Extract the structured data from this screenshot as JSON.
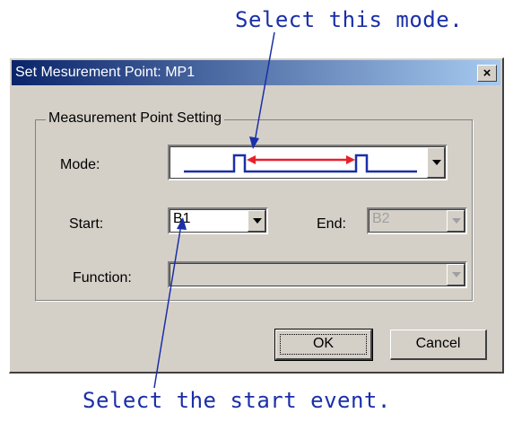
{
  "annotations": {
    "top": "Select this mode.",
    "bottom": "Select the start event."
  },
  "dialog": {
    "title": "Set Mesurement Point: MP1",
    "close_symbol": "×",
    "group_title": "Measurement Point Setting",
    "mode": {
      "label": "Mode:",
      "icon": "pulse-interval-waveform-icon"
    },
    "start": {
      "label": "Start:",
      "value": "B1"
    },
    "end": {
      "label": "End:",
      "value": "B2",
      "disabled": true
    },
    "function": {
      "label": "Function:",
      "value": "",
      "disabled": true
    },
    "ok_label": "OK",
    "cancel_label": "Cancel"
  },
  "colors": {
    "title_gradient_start": "#0a246a",
    "title_gradient_end": "#a6caf0",
    "dialog_face": "#d4d0c8",
    "annotation": "#1a2fa8",
    "waveform": "#1a2fa8",
    "interval_arrow": "#e8202a"
  }
}
